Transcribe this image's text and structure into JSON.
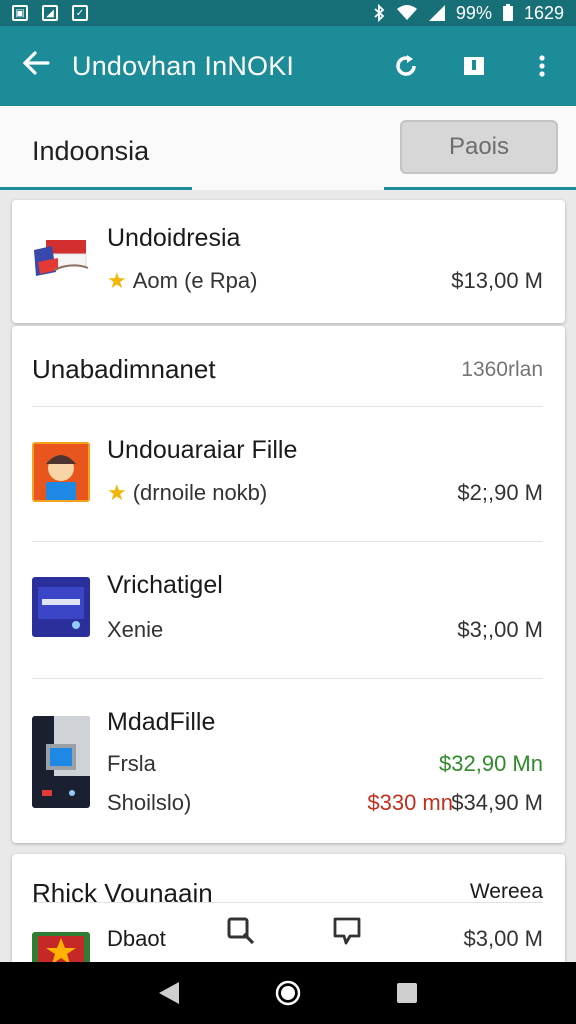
{
  "status_bar": {
    "battery": "99%",
    "time": "1629"
  },
  "app_bar": {
    "title": "Undovhan InNOKI"
  },
  "tab_row": {
    "country_label": "Indoonsia",
    "pill_label": "Paois"
  },
  "card1": {
    "name": "Undoidresia",
    "subtitle": "Aom (e Rpa)",
    "price": "$13,00 M"
  },
  "card2": {
    "section_title": "Unabadimnanet",
    "section_meta": "1360rlan",
    "items": [
      {
        "name": "Undouaraiar Fille",
        "subtitle": "(drnoile nokb)",
        "price": "$2;,90 M"
      },
      {
        "name": "Vrichatigel",
        "subtitle": "Xenie",
        "price": "$3;,00 M"
      },
      {
        "name": "MdadFille",
        "subtitle": "Frsla",
        "subtitle2": "Shoilslo)",
        "price_green": "$32,90 Mn",
        "price_red": "$330 mn",
        "price": "$34,90 M"
      }
    ]
  },
  "card3": {
    "section_title": "Rhick Vounaain",
    "section_meta": "Wereea",
    "item": {
      "name": "Dbaot",
      "price": "$3,00 M"
    }
  },
  "colors": {
    "app_bar": "#1b8c98",
    "status_bar": "#176f78",
    "green_price": "#2f8a2a",
    "red_price": "#c0301f"
  },
  "icons": [
    "back-arrow-icon",
    "refresh-icon",
    "bookmark-icon",
    "more-vert-icon",
    "search-icon",
    "chat-icon",
    "star-icon",
    "nav-back-icon",
    "nav-home-icon",
    "nav-recents-icon"
  ]
}
